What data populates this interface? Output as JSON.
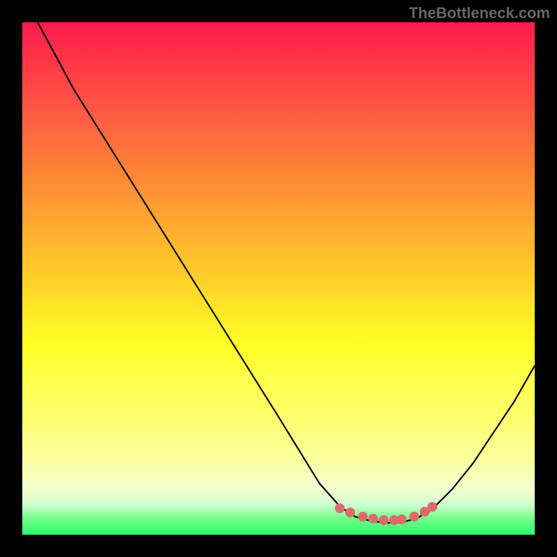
{
  "watermark": "TheBottleneck.com",
  "chart_data": {
    "type": "line",
    "title": "",
    "xlabel": "",
    "ylabel": "",
    "xlim": [
      0,
      100
    ],
    "ylim": [
      0,
      100
    ],
    "grid": false,
    "curve_points": [
      {
        "x": 3.0,
        "y": 100.0
      },
      {
        "x": 10.0,
        "y": 87.0
      },
      {
        "x": 20.0,
        "y": 71.0
      },
      {
        "x": 30.0,
        "y": 55.0
      },
      {
        "x": 40.0,
        "y": 39.0
      },
      {
        "x": 50.0,
        "y": 23.0
      },
      {
        "x": 58.0,
        "y": 10.0
      },
      {
        "x": 62.0,
        "y": 5.5
      },
      {
        "x": 65.0,
        "y": 3.5
      },
      {
        "x": 68.0,
        "y": 2.7
      },
      {
        "x": 71.0,
        "y": 2.3
      },
      {
        "x": 74.0,
        "y": 2.4
      },
      {
        "x": 77.0,
        "y": 3.2
      },
      {
        "x": 80.0,
        "y": 5.0
      },
      {
        "x": 84.0,
        "y": 9.0
      },
      {
        "x": 88.0,
        "y": 14.0
      },
      {
        "x": 92.0,
        "y": 20.0
      },
      {
        "x": 96.0,
        "y": 26.0
      },
      {
        "x": 100.0,
        "y": 33.0
      }
    ],
    "marker_points": [
      {
        "x": 62.0,
        "y": 5.2
      },
      {
        "x": 64.0,
        "y": 4.3
      },
      {
        "x": 66.5,
        "y": 3.6
      },
      {
        "x": 68.5,
        "y": 3.1
      },
      {
        "x": 70.5,
        "y": 2.9
      },
      {
        "x": 72.5,
        "y": 2.8
      },
      {
        "x": 74.0,
        "y": 3.0
      },
      {
        "x": 76.5,
        "y": 3.6
      },
      {
        "x": 78.5,
        "y": 4.5
      },
      {
        "x": 80.0,
        "y": 5.5
      }
    ],
    "marker_color": "#dd6b6b",
    "gradient_top": "#ff1a4d",
    "gradient_bottom": "#2eff6d"
  }
}
